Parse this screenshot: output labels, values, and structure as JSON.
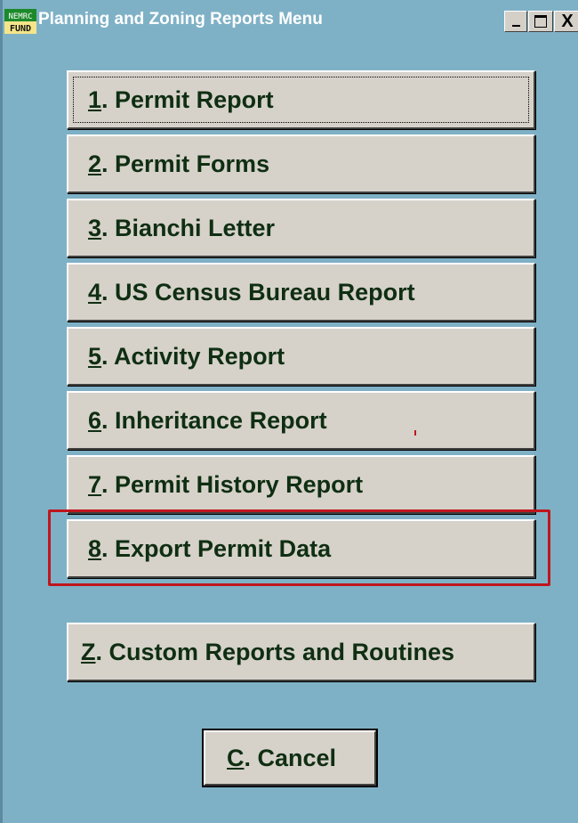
{
  "window": {
    "title": "Planning and  Zoning Reports Menu",
    "icon_text_top": "NEMRC",
    "icon_text_bottom": "FUND",
    "controls": {
      "minimize": "_",
      "maximize": "□",
      "close": "X"
    }
  },
  "menu": {
    "items": [
      {
        "key": "1",
        "rest": ". Permit Report"
      },
      {
        "key": "2",
        "rest": ". Permit Forms"
      },
      {
        "key": "3",
        "rest": ". Bianchi Letter"
      },
      {
        "key": "4",
        "rest": ". US Census Bureau Report"
      },
      {
        "key": "5",
        "rest": ". Activity Report"
      },
      {
        "key": "6",
        "rest": ". Inheritance Report"
      },
      {
        "key": "7",
        "rest": ". Permit History Report"
      },
      {
        "key": "8",
        "rest": ". Export Permit Data"
      }
    ],
    "custom": {
      "key": "Z",
      "rest": ". Custom Reports and Routines"
    },
    "cancel": {
      "key": "C",
      "rest": ". Cancel"
    }
  },
  "colors": {
    "background": "#7fb1c6",
    "button_face": "#d6d2ca",
    "button_text": "#0f2e12",
    "highlight": "#c0151d"
  }
}
